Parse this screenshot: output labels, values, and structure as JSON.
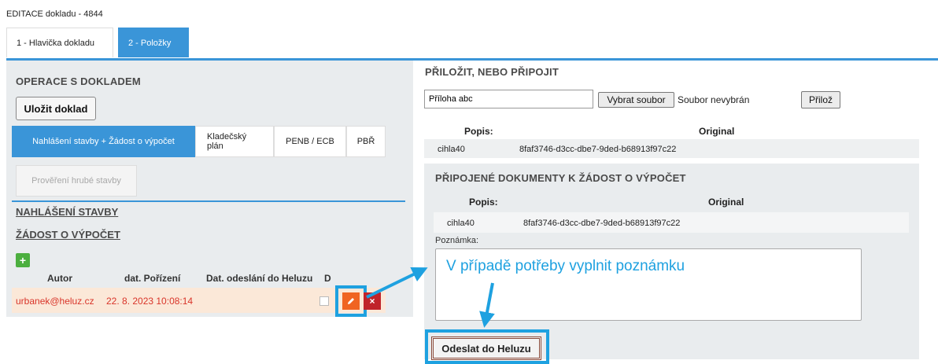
{
  "page": {
    "title": "EDITACE dokladu - 4844"
  },
  "tabs": [
    {
      "label": "1 - Hlavička dokladu"
    },
    {
      "label": "2 - Položky"
    }
  ],
  "left": {
    "section_title": "OPERACE S DOKLADEM",
    "save_button": "Uložit doklad",
    "op_tabs": [
      {
        "label": "Nahlášení stavby + Žádost o výpočet"
      },
      {
        "label": "Kladečský plán"
      },
      {
        "label": "PENB / ECB"
      },
      {
        "label": "PBŘ"
      }
    ],
    "check_button": "Prověření hrubé stavby",
    "nahlaseni": "NAHLÁŠENÍ STAVBY",
    "zadost": "ŽÁDOST O VÝPOČET",
    "add_icon": "+",
    "table": {
      "headers": [
        "Autor",
        "dat. Pořízení",
        "Dat. odeslání do Heluzu",
        "D"
      ],
      "row": {
        "autor": "urbanek@heluz.cz",
        "datum": "22. 8. 2023 10:08:14"
      }
    },
    "delete_icon": "×"
  },
  "right": {
    "attach_title": "PŘILOŽIT, NEBO PŘIPOJIT",
    "attach_input_value": "Příloha abc",
    "choose_file_button": "Vybrat soubor",
    "no_file_text": "Soubor nevybrán",
    "attach_button": "Přilož",
    "grid_headers": {
      "popis": "Popis:",
      "original": "Original"
    },
    "grid_row": {
      "popis": "cihla40",
      "original": "8faf3746-d3cc-dbe7-9ded-b68913f97c22"
    },
    "connected_title": "PŘIPOJENÉ DOKUMENTY K ŽÁDOST O VÝPOČET",
    "connected_headers": {
      "popis": "Popis:",
      "original": "Original"
    },
    "connected_row": {
      "popis": "cihla40",
      "original": "8faf3746-d3cc-dbe7-9ded-b68913f97c22"
    },
    "note_label": "Poznámka:",
    "note_annotation": "V případě potřeby vyplnit poznámku",
    "send_button": "Odeslat do Heluzu"
  },
  "colors": {
    "accent": "#3a95d8",
    "highlight": "#1ea1e0",
    "edit": "#f06422",
    "delete": "#c0232a",
    "add": "#4caf3f"
  }
}
